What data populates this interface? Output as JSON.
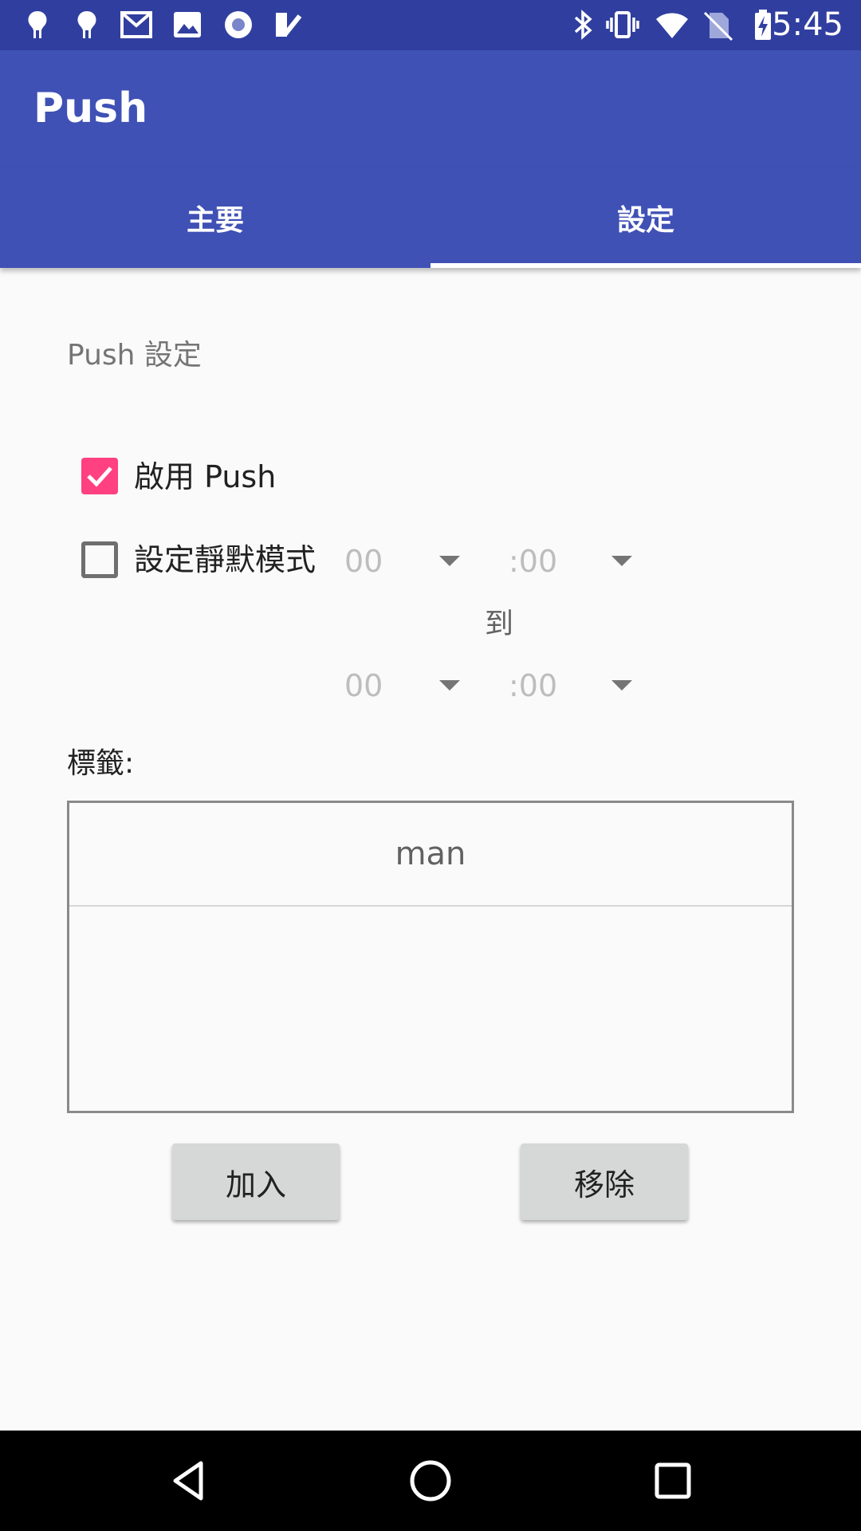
{
  "status_bar": {
    "time": "5:45",
    "left_icons": [
      "app-notification-icon",
      "app-notification-icon",
      "gmail-icon",
      "image-icon",
      "record-icon",
      "checklist-icon"
    ],
    "right_icons": [
      "bluetooth-icon",
      "vibrate-icon",
      "wifi-icon",
      "no-sim-icon",
      "battery-charging-icon"
    ]
  },
  "app_bar": {
    "title": "Push"
  },
  "tabs": [
    {
      "label": "主要",
      "selected": false
    },
    {
      "label": "設定",
      "selected": true
    }
  ],
  "settings": {
    "section_title": "Push 設定",
    "enable_push": {
      "label": "啟用 Push",
      "checked": true
    },
    "quiet_mode": {
      "label": "設定靜默模式",
      "checked": false,
      "from_hour": "00",
      "from_minute": ":00",
      "to_label": "到",
      "to_hour": "00",
      "to_minute": ":00"
    },
    "tags_label": "標籤:",
    "tags": [
      "man"
    ],
    "add_button": "加入",
    "remove_button": "移除"
  },
  "colors": {
    "status_bar": "#303F9F",
    "primary": "#3F51B5",
    "accent": "#FF4081",
    "background": "#FAFAFA"
  }
}
